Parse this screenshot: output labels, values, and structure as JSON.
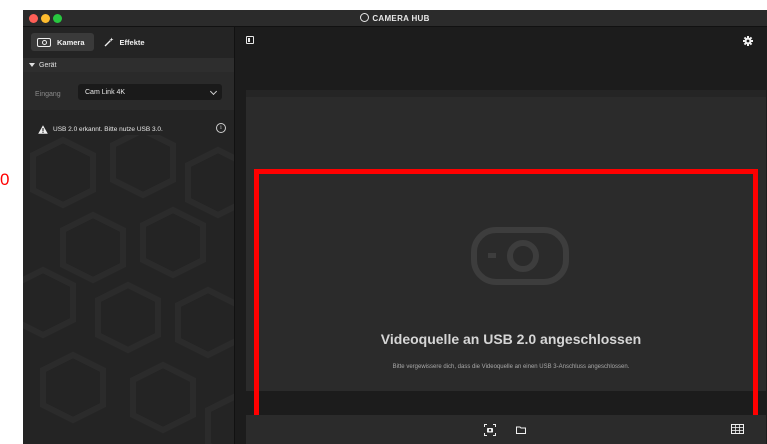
{
  "window": {
    "title": "CAMERA HUB"
  },
  "left_edge_text": "0",
  "sidebar": {
    "tabs": [
      {
        "label": "Kamera",
        "active": true,
        "icon": "camera-icon"
      },
      {
        "label": "Effekte",
        "active": false,
        "icon": "magic-wand-icon"
      }
    ],
    "section": {
      "label": "Gerät",
      "expanded": true
    },
    "input": {
      "label": "Eingang",
      "selected": "Cam Link 4K"
    },
    "warning": {
      "text": "USB 2.0 erkannt. Bitte nutze USB 3.0.",
      "icon": "warning-triangle-icon",
      "info_icon": "info-icon"
    }
  },
  "main": {
    "preview": {
      "title": "Videoquelle an USB 2.0 angeschlossen",
      "subtitle": "Bitte vergewissere dich, dass die Videoquelle an einen USB 3-Anschluss angeschlossen.",
      "placeholder_icon": "camera-placeholder-icon"
    },
    "toolbar_icons": [
      "sidebar-toggle-icon",
      "gear-icon"
    ],
    "bottom_icons": [
      "snapshot-icon",
      "folder-icon",
      "grid-icon"
    ]
  },
  "colors": {
    "highlight": "#ff0000",
    "background": "#1c1c1c",
    "panel": "#2b2b2b",
    "traffic_red": "#ff5f57",
    "traffic_yellow": "#febc2e",
    "traffic_green": "#28c840"
  }
}
